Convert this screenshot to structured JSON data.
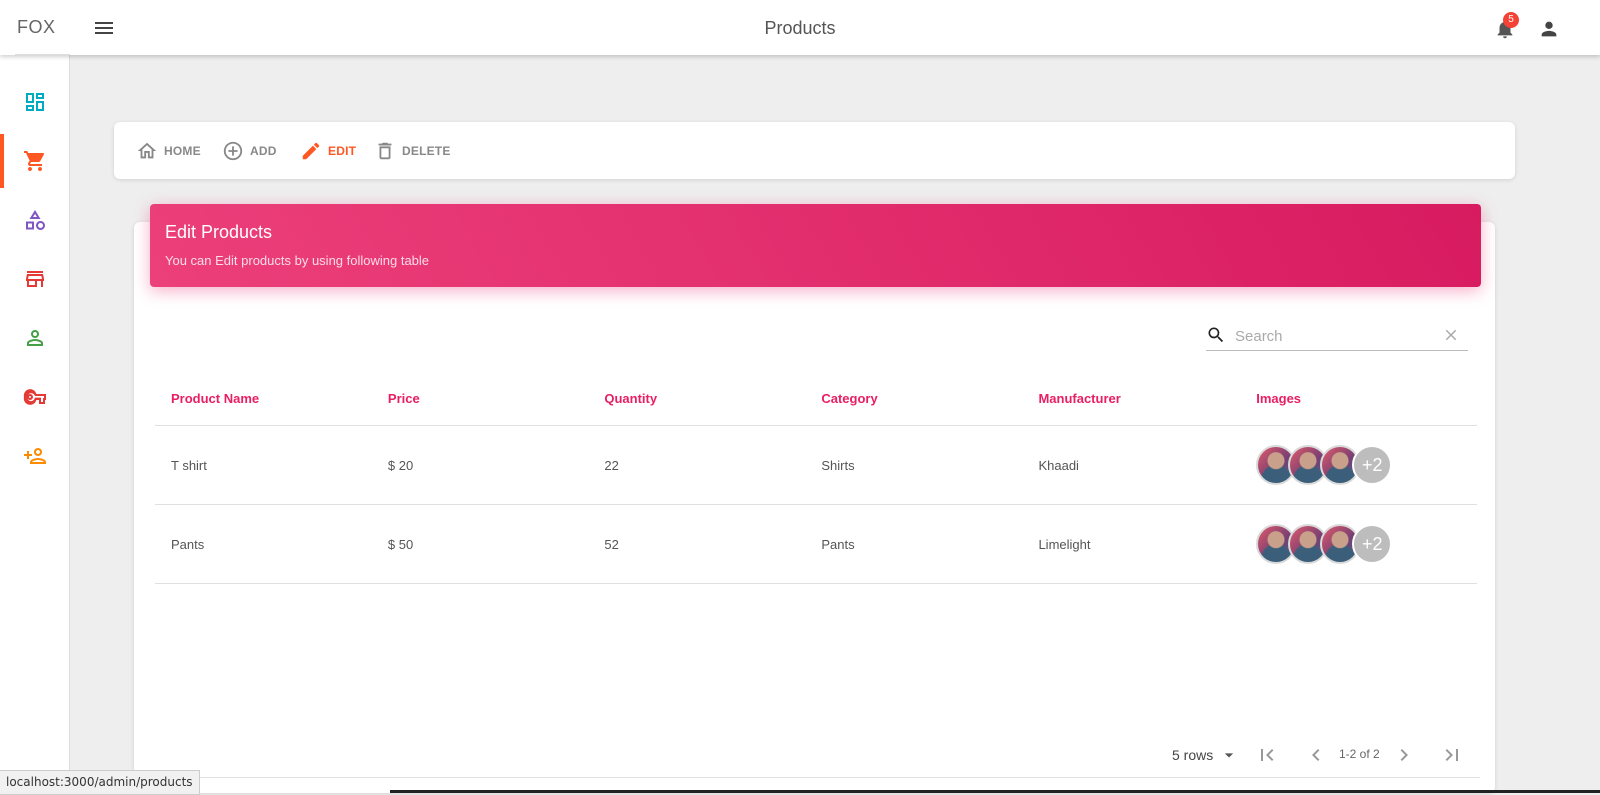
{
  "app": {
    "brand": "FOX",
    "page_title": "Products",
    "notification_count": "5"
  },
  "sidebar": {
    "items": [
      {
        "name": "dashboard",
        "icon": "dashboard-icon",
        "color": "#00acc1"
      },
      {
        "name": "products",
        "icon": "cart-icon",
        "color": "#ff5722",
        "active": true
      },
      {
        "name": "categories",
        "icon": "shapes-icon",
        "color": "#7e57c2"
      },
      {
        "name": "stores",
        "icon": "store-icon",
        "color": "#e53935"
      },
      {
        "name": "users",
        "icon": "person-icon",
        "color": "#43a047"
      },
      {
        "name": "roles",
        "icon": "key-icon",
        "color": "#e53935"
      },
      {
        "name": "add-user",
        "icon": "person-add-icon",
        "color": "#fb8c00"
      }
    ]
  },
  "toolbar": {
    "home_label": "HOME",
    "add_label": "ADD",
    "edit_label": "EDIT",
    "delete_label": "DELETE",
    "active": "EDIT",
    "accent": "#ff5722"
  },
  "card": {
    "title": "Edit Products",
    "subtitle": "You can Edit products by using following table"
  },
  "search": {
    "placeholder": "Search",
    "value": ""
  },
  "table": {
    "headers": [
      "Product Name",
      "Price",
      "Quantity",
      "Category",
      "Manufacturer",
      "Images"
    ],
    "rows": [
      {
        "name": "T shirt",
        "price": "$ 20",
        "quantity": "22",
        "category": "Shirts",
        "manufacturer": "Khaadi",
        "more_images": "+2"
      },
      {
        "name": "Pants",
        "price": "$ 50",
        "quantity": "52",
        "category": "Pants",
        "manufacturer": "Limelight",
        "more_images": "+2"
      }
    ]
  },
  "pagination": {
    "rows_per_page": "5 rows",
    "range": "1-2 of 2"
  },
  "status_bar": {
    "url": "localhost:3000/admin/products"
  }
}
